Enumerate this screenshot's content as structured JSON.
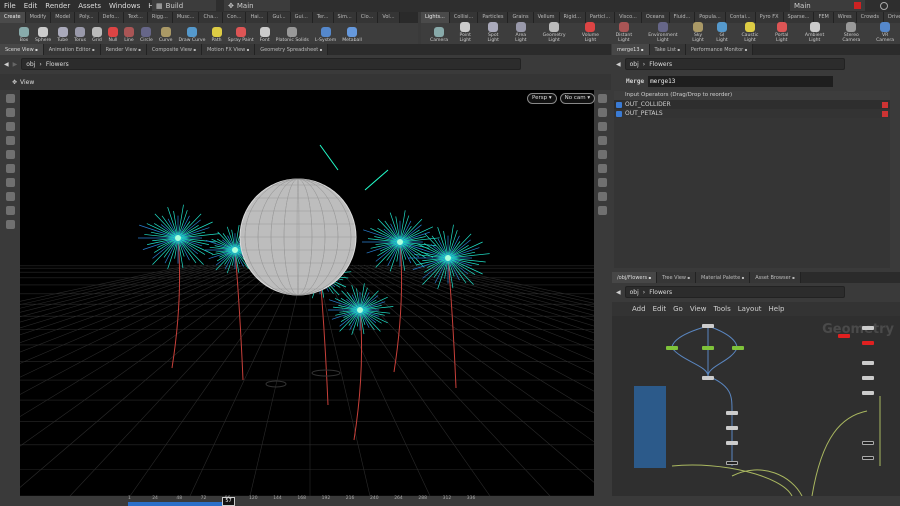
{
  "menubar": {
    "items": [
      "File",
      "Edit",
      "Render",
      "Assets",
      "Windows",
      "Help"
    ],
    "desktop": "Build",
    "context": "Main",
    "right_context": "Main"
  },
  "left_shelf": {
    "tabs": [
      "Create",
      "Modify",
      "Model",
      "Poly...",
      "Defo...",
      "Text...",
      "Rigg...",
      "Musc...",
      "Cha...",
      "Con...",
      "Hai...",
      "Gui...",
      "Gui...",
      "Ter...",
      "Sim...",
      "Clo...",
      "Vol..."
    ],
    "tools": [
      "Box",
      "Sphere",
      "Tube",
      "Torus",
      "Grid",
      "Null",
      "Line",
      "Circle",
      "Curve",
      "Draw Curve",
      "Path",
      "Spray Paint",
      "Font",
      "Platonic Solids",
      "L-System",
      "Metaball"
    ]
  },
  "right_shelf": {
    "tabs": [
      "Lights...",
      "Collisi...",
      "Particles",
      "Grains",
      "Vellum",
      "Rigid...",
      "Particl...",
      "Visco...",
      "Oceans",
      "Fluid...",
      "Popula...",
      "Contai...",
      "Pyro FX",
      "Sparse...",
      "FEM",
      "Wires",
      "Crowds",
      "Drive..."
    ],
    "tools": [
      "Camera",
      "Point Light",
      "Spot Light",
      "Area Light",
      "Geometry Light",
      "Volume Light",
      "Distant Light",
      "Environment Light",
      "Sky Light",
      "GI Light",
      "Caustic Light",
      "Portal Light",
      "Ambient Light",
      "Stereo Camera",
      "VR Camera"
    ]
  },
  "scene_pane": {
    "tabs": [
      "Scene View",
      "Animation Editor",
      "Render View",
      "Composite View",
      "Motion FX View",
      "Geometry Spreadsheet"
    ],
    "path": [
      "obj",
      "Flowers"
    ],
    "view_label": "View",
    "persp": "Persp ▾",
    "cam": "No cam ▾"
  },
  "param_pane": {
    "tabs": [
      "merge13",
      "Take List",
      "Performance Monitor"
    ],
    "path": [
      "obj",
      "Flowers"
    ],
    "node_type": "Merge",
    "node_name": "merge13",
    "list_header": "Input Operators (Drag/Drop to reorder)",
    "inputs": [
      "OUT_COLLIDER",
      "OUT_PETALS"
    ]
  },
  "network_pane": {
    "tabs": [
      "/obj/Flowers",
      "Tree View",
      "Material Palette",
      "Asset Browser"
    ],
    "path": [
      "obj",
      "Flowers"
    ],
    "menu": [
      "Add",
      "Edit",
      "Go",
      "View",
      "Tools",
      "Layout",
      "Help"
    ],
    "watermark": "Geometry"
  },
  "timeline": {
    "current_frame": "57",
    "ticks": [
      "1",
      "24",
      "48",
      "72",
      "96",
      "120",
      "144",
      "168",
      "192",
      "216",
      "240",
      "264",
      "288",
      "312",
      "336"
    ],
    "range_start": 1,
    "range_end": 240
  },
  "colors": {
    "accent_blue": "#2a6fc9",
    "flower": "#20e0c8",
    "node_green": "#7fc33a",
    "node_red": "#e02020"
  }
}
